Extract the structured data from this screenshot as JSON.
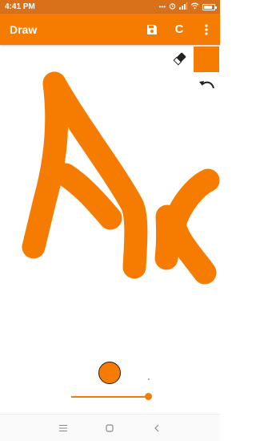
{
  "status_bar": {
    "time": "4:41 PM",
    "icons": [
      "more-dots-icon",
      "alarm-icon",
      "signal-icon",
      "wifi-icon",
      "battery-icon"
    ],
    "battery_level": 0.8
  },
  "app_bar": {
    "title": "Draw",
    "save_icon": "save-icon",
    "clear_label": "C",
    "menu_icon": "more-vert-icon",
    "background": "#f57c00"
  },
  "tools": {
    "selected_color": "#f57c00",
    "eraser_icon": "eraser-icon",
    "undo_icon": "undo-icon"
  },
  "brush": {
    "color": "#f57c00",
    "size_level": 1.0
  },
  "nav_bar": {
    "icons": [
      "recent-apps-icon",
      "home-icon",
      "back-icon"
    ]
  }
}
